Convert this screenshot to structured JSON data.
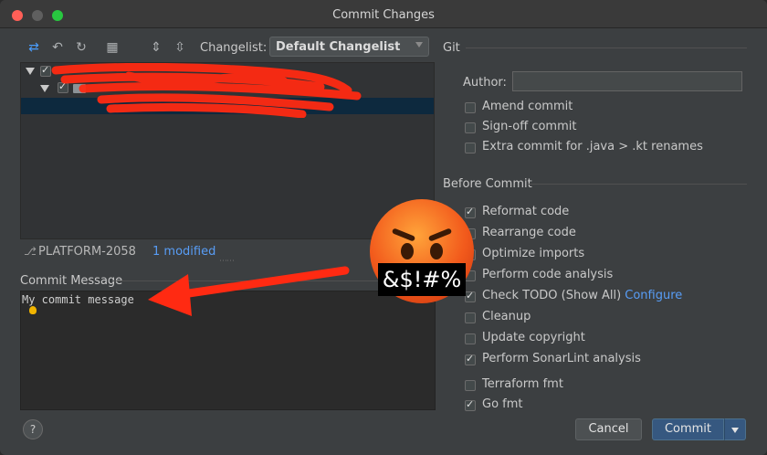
{
  "window": {
    "title": "Commit Changes"
  },
  "toolbar": {
    "icons": [
      "diff-icon",
      "undo-icon",
      "refresh-icon",
      "group-icon",
      "expand-icon",
      "collapse-icon"
    ],
    "changelist_label": "Changelist:",
    "changelist_value": "Default Changelist"
  },
  "status": {
    "branch": "PLATFORM-2058",
    "modified": "1 modified"
  },
  "commit_message": {
    "label": "Commit Message",
    "text": "My commit message"
  },
  "git": {
    "section_title": "Git",
    "author_label": "Author:",
    "author_value": "",
    "options": [
      {
        "label": "Amend commit",
        "checked": false
      },
      {
        "label": "Sign-off commit",
        "checked": false
      },
      {
        "label": "Extra commit for .java > .kt renames",
        "checked": false
      }
    ]
  },
  "before_commit": {
    "section_title": "Before Commit",
    "options": [
      {
        "label": "Reformat code",
        "checked": true
      },
      {
        "label": "Rearrange code",
        "checked": false
      },
      {
        "label": "Optimize imports",
        "checked": false
      },
      {
        "label": "Perform code analysis",
        "checked": false
      },
      {
        "label": "Check TODO (Show All)",
        "link": "Configure",
        "checked": true
      },
      {
        "label": "Cleanup",
        "checked": false
      },
      {
        "label": "Update copyright",
        "checked": false
      },
      {
        "label": "Perform SonarLint analysis",
        "checked": true
      },
      {
        "label": "Terraform fmt",
        "checked": false
      },
      {
        "label": "Go fmt",
        "checked": true
      }
    ]
  },
  "buttons": {
    "help": "?",
    "cancel": "Cancel",
    "commit": "Commit"
  },
  "overlay": {
    "censored_text": "&$!#%"
  },
  "colors": {
    "accent": "#589df6",
    "primary_button": "#365880",
    "scribble": "#ff2a12"
  }
}
